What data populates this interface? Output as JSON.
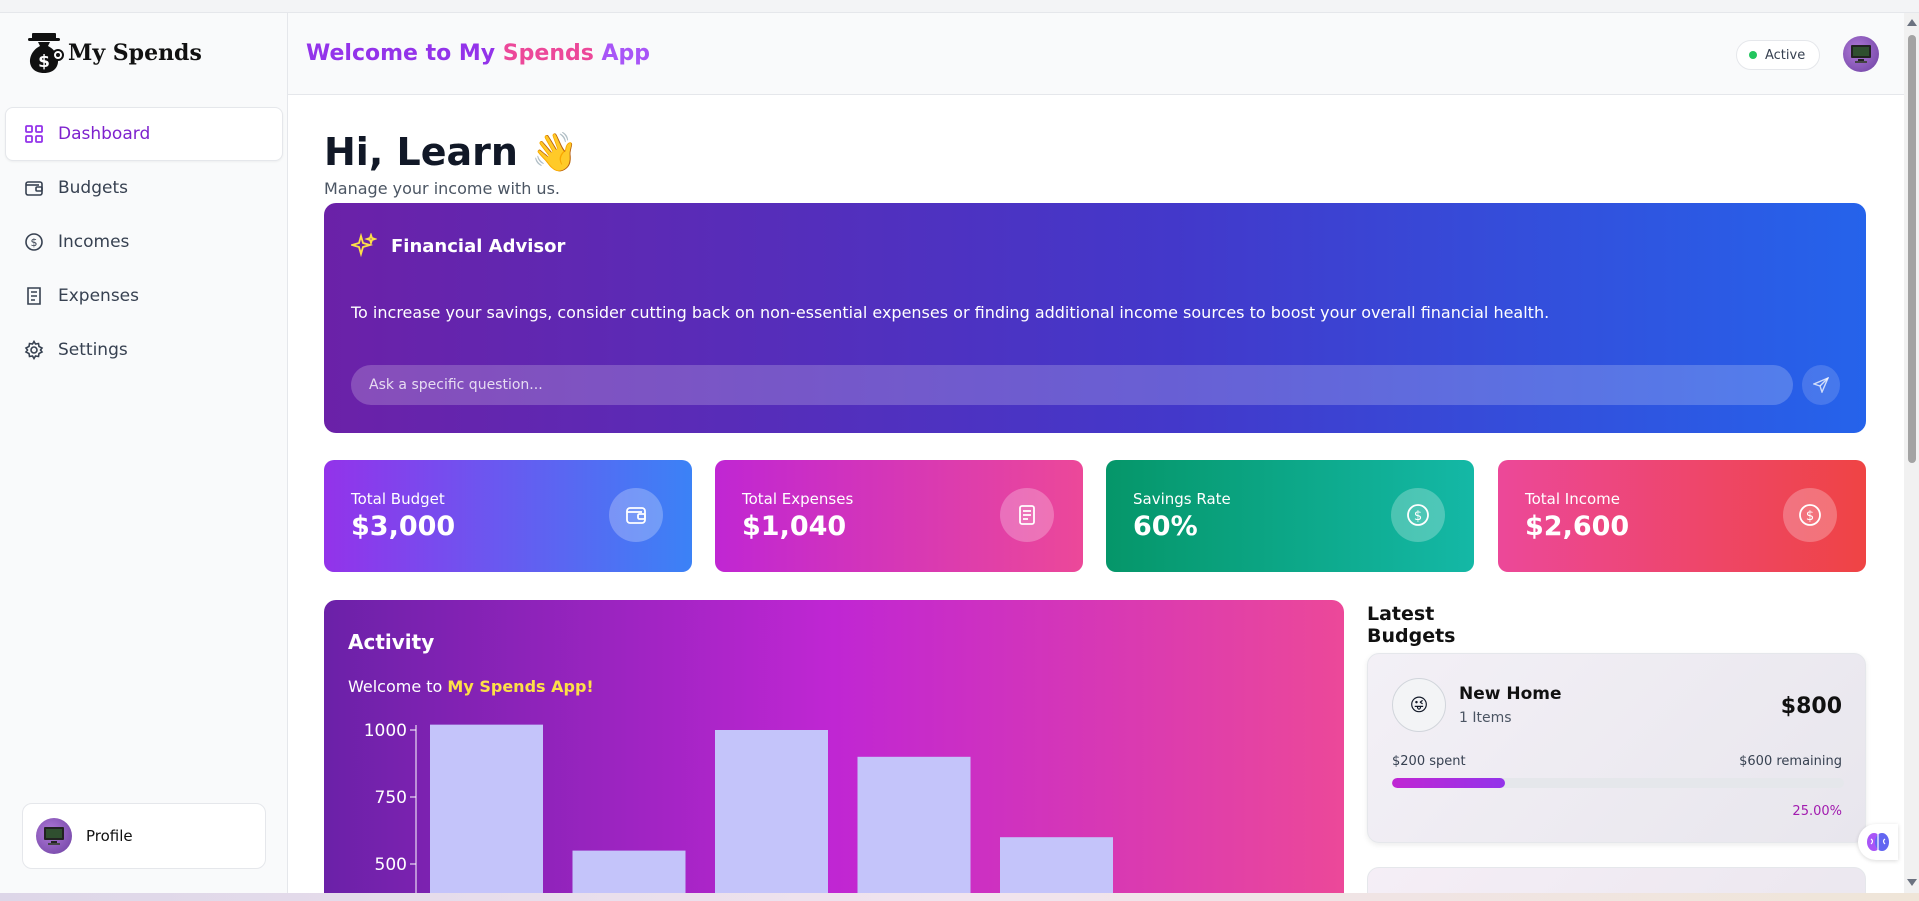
{
  "app": {
    "logo_text": "My Spends"
  },
  "header": {
    "welcome_part1": "Welcome to My",
    "welcome_part2": " Spends",
    "welcome_part3": " App",
    "status": "Active"
  },
  "sidebar": {
    "items": [
      {
        "label": "Dashboard",
        "icon": "grid-icon",
        "active": true
      },
      {
        "label": "Budgets",
        "icon": "wallet-icon",
        "active": false
      },
      {
        "label": "Incomes",
        "icon": "dollar-circle-icon",
        "active": false
      },
      {
        "label": "Expenses",
        "icon": "receipt-icon",
        "active": false
      },
      {
        "label": "Settings",
        "icon": "gear-icon",
        "active": false
      }
    ],
    "profile_label": "Profile"
  },
  "main": {
    "greeting": "Hi, Learn 👋",
    "subtitle": "Manage your income with us."
  },
  "advisor": {
    "title": "Financial Advisor",
    "message": "To increase your savings, consider cutting back on non-essential expenses or finding additional income sources to boost your overall financial health.",
    "input_placeholder": "Ask a specific question..."
  },
  "stats": [
    {
      "label": "Total Budget",
      "value": "$3,000",
      "icon": "wallet-icon",
      "gradient": [
        "#9333ea",
        "#3b82f6"
      ]
    },
    {
      "label": "Total Expenses",
      "value": "$1,040",
      "icon": "receipt-icon",
      "gradient": [
        "#c026d3",
        "#ec4899"
      ]
    },
    {
      "label": "Savings Rate",
      "value": "60%",
      "icon": "dollar-circle-icon",
      "gradient": [
        "#059669",
        "#14b8a6"
      ]
    },
    {
      "label": "Total Income",
      "value": "$2,600",
      "icon": "dollar-circle-icon",
      "gradient": [
        "#ec4899",
        "#ef4444"
      ]
    }
  ],
  "activity": {
    "title": "Activity",
    "welcome_prefix": "Welcome to ",
    "welcome_highlight": "My Spends App!"
  },
  "chart_data": {
    "type": "bar",
    "values": [
      1020,
      550,
      1000,
      900,
      600
    ],
    "y_ticks": [
      1000,
      750,
      500
    ],
    "ylim": [
      0,
      1000
    ],
    "bar_color": "#c4c4fa"
  },
  "latest_budgets": {
    "title": "Latest Budgets",
    "items": [
      {
        "emoji": "😜",
        "name": "New Home",
        "items_count": "1 Items",
        "amount": "$800",
        "spent_text": "$200 spent",
        "remaining_text": "$600 remaining",
        "progress_pct": 25,
        "progress_text": "25.00%"
      }
    ]
  }
}
